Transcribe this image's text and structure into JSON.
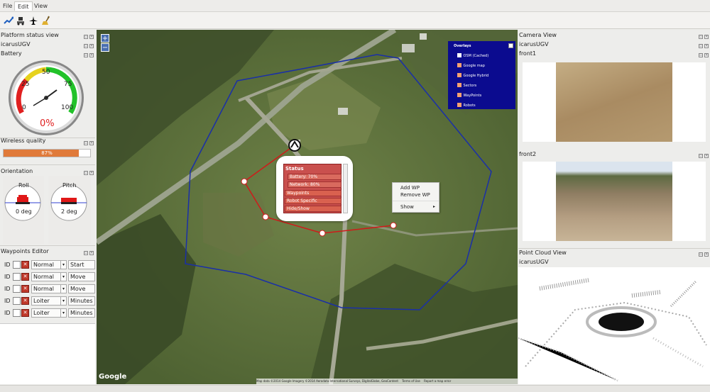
{
  "menubar": {
    "items": [
      "File",
      "Edit",
      "View"
    ],
    "active_index": 1
  },
  "toolbar": {
    "icons": [
      "route-icon",
      "robot-icon",
      "plane-icon",
      "broom-icon"
    ]
  },
  "left": {
    "platform_status_title": "Platform status view",
    "robot_name": "icarusUGV",
    "battery_title": "Battery",
    "battery_gauge": {
      "ticks": [
        "0",
        "25",
        "50",
        "75",
        "100"
      ],
      "value_label": "0%",
      "value": 0
    },
    "wireless_title": "Wireless quality",
    "wireless_label": "87%",
    "wireless_value": 87,
    "orientation_title": "Orientation",
    "roll_label": "Roll",
    "roll_value": "0 deg",
    "pitch_label": "Pitch",
    "pitch_value": "2 deg",
    "waypoints_title": "Waypoints Editor",
    "waypoints": [
      {
        "id": "ID",
        "mode": "Normal",
        "action": "Start"
      },
      {
        "id": "ID",
        "mode": "Normal",
        "action": "Move"
      },
      {
        "id": "ID",
        "mode": "Normal",
        "action": "Move"
      },
      {
        "id": "ID",
        "mode": "Loiter",
        "action": "Minutes"
      },
      {
        "id": "ID",
        "mode": "Loiter",
        "action": "Minutes"
      }
    ]
  },
  "map": {
    "zoom_in": "+",
    "zoom_out": "−",
    "overlays": {
      "title": "Overlays",
      "items": [
        {
          "label": "OSM (Cached)",
          "checked": false
        },
        {
          "label": "Google map",
          "checked": true
        },
        {
          "label": "Google Hybrid",
          "checked": true
        },
        {
          "label": "Sectors",
          "checked": true
        },
        {
          "label": "WayPoints",
          "checked": true
        },
        {
          "label": "Robots",
          "checked": true
        }
      ]
    },
    "status_popup": {
      "header": "Status",
      "battery": "Battery: 70%",
      "network": "Network: 80%",
      "items": [
        "Waypoints",
        "Robot Specific",
        "Hide/Show"
      ]
    },
    "context_menu": {
      "items": [
        "Add WP",
        "Remove WP",
        "Show"
      ]
    },
    "google_logo": "Google",
    "attribution": "Map data ©2014 Google Imagery ©2014 Aerodata International Surveys, DigitalGlobe, GeoContent",
    "terms": "Terms of Use",
    "report": "Report a map error",
    "colors": {
      "sector": "#1a2fa8",
      "route": "#d01a1a",
      "overlay_bg": "#0b0b8f"
    }
  },
  "right": {
    "camera_title": "Camera View",
    "robot_name": "icarusUGV",
    "front1": "front1",
    "front2": "front2",
    "pointcloud_title": "Point Cloud View",
    "pointcloud_robot": "icarusUGV"
  }
}
